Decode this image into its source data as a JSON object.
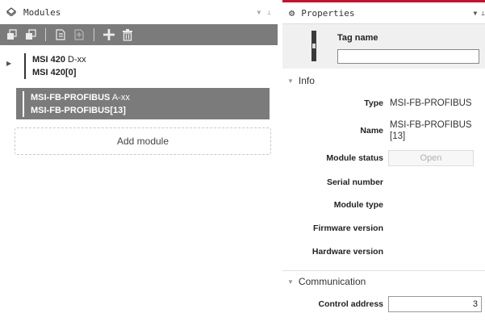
{
  "modules_pane": {
    "title": "Modules",
    "header_icon": "modules-icon",
    "toolbar": {
      "buttons": [
        {
          "icon": "collapse-all-icon"
        },
        {
          "icon": "expand-all-icon"
        },
        {
          "icon": "import-icon"
        },
        {
          "icon": "export-icon"
        },
        {
          "icon": "add-icon"
        },
        {
          "icon": "delete-icon"
        }
      ]
    },
    "modules": [
      {
        "name": "MSI 420",
        "version": "D-xx",
        "instance": "MSI 420[0]",
        "expandable": true,
        "selected": false
      },
      {
        "name": "MSI-FB-PROFIBUS",
        "version": "A-xx",
        "instance": "MSI-FB-PROFIBUS[13]",
        "expandable": false,
        "selected": true
      }
    ],
    "add_module_label": "Add module"
  },
  "properties_pane": {
    "title": "Properties",
    "accent_color": "#c8102e",
    "tag_name_label": "Tag name",
    "tag_name_value": "",
    "sections": {
      "info": {
        "title": "Info",
        "type_label": "Type",
        "type_value": "MSI-FB-PROFIBUS",
        "name_label": "Name",
        "name_value": "MSI-FB-PROFIBUS [13]",
        "module_status_label": "Module status",
        "module_status_button": "Open",
        "serial_number_label": "Serial number",
        "module_type_label": "Module type",
        "firmware_version_label": "Firmware version",
        "hardware_version_label": "Hardware version"
      },
      "communication": {
        "title": "Communication",
        "control_address_label": "Control address",
        "control_address_value": "3"
      }
    }
  },
  "colors": {
    "toolbar_bg": "#7b7b7b",
    "selected_bg": "#7b7b7b"
  }
}
